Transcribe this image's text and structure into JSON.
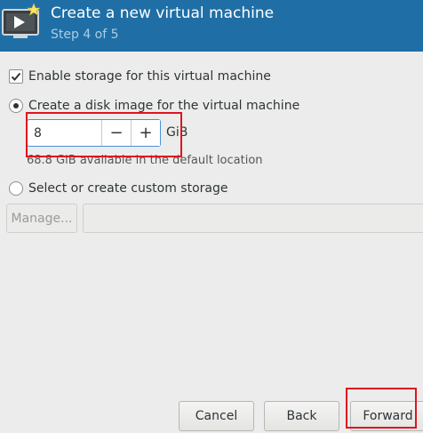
{
  "header": {
    "title": "Create a new virtual machine",
    "subtitle": "Step 4 of 5",
    "icon": "virtual-machine-icon",
    "background_color": "#1f6fa6"
  },
  "storage": {
    "enable_label": "Enable storage for this virtual machine",
    "enable_checked": true,
    "create_disk_label": "Create a disk image for the virtual machine",
    "create_disk_selected": true,
    "size_value": "8",
    "size_unit": "GiB",
    "decrement_symbol": "−",
    "increment_symbol": "+",
    "available_text": "68.8 GiB available in the default location",
    "custom_label": "Select or create custom storage",
    "custom_selected": false,
    "manage_label": "Manage...",
    "custom_path_value": ""
  },
  "footer": {
    "cancel_label": "Cancel",
    "back_label": "Back",
    "forward_label": "Forward"
  },
  "highlight_color": "#e0141e"
}
